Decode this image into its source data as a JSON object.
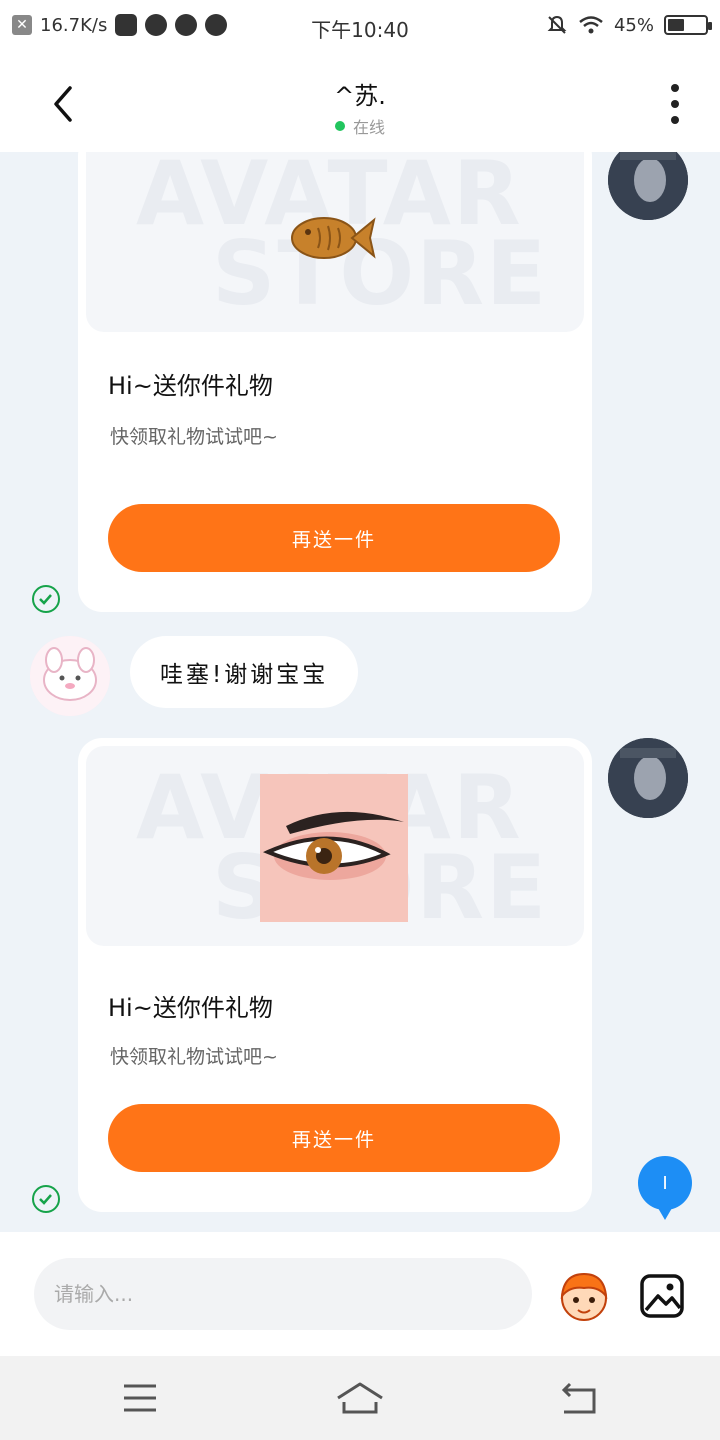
{
  "status_bar": {
    "net_speed": "16.7K/s",
    "time": "下午10:40",
    "battery": "45%",
    "battery_level": 0.45
  },
  "header": {
    "contact_name": "^苏.",
    "presence": "在线",
    "presence_color": "#22c55e"
  },
  "messages": {
    "gift_1": {
      "title": "Hi~送你件礼物",
      "subtitle": "快领取礼物试试吧~",
      "button": "再送一件",
      "watermark_line1": "AVATAR",
      "watermark_line2": "STORE"
    },
    "reply": {
      "text": "哇塞!谢谢宝宝"
    },
    "gift_2": {
      "title": "Hi~送你件礼物",
      "subtitle": "快领取礼物试试吧~",
      "button": "再送一件",
      "watermark_line1": "AVATAR",
      "watermark_line2": "STORE"
    }
  },
  "fab": {
    "label": "I"
  },
  "input": {
    "placeholder": "请输入..."
  },
  "colors": {
    "accent": "#ff7417",
    "check": "#16a34a",
    "fab": "#1d8ef5",
    "background": "#eef3f8"
  },
  "icons": {
    "back": "back-arrow-icon",
    "more": "more-vertical-icon",
    "emoji": "emoji-mascot-icon",
    "image": "image-icon",
    "gift_1": "fish-cookie-icon",
    "gift_2": "eye-makeup-icon"
  }
}
